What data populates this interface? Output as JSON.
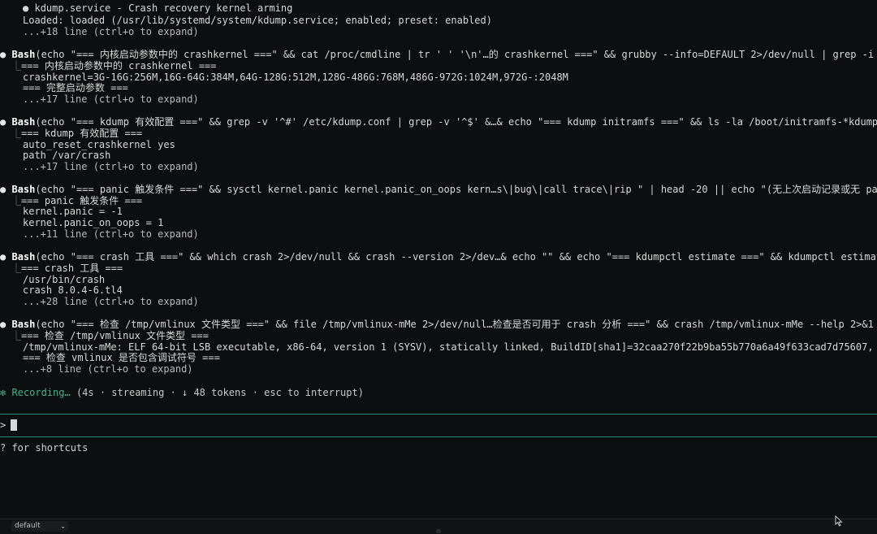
{
  "terminal": {
    "service_block": {
      "bullet": "●",
      "title": "kdump.service - Crash recovery kernel arming",
      "loaded": "Loaded: loaded (/usr/lib/systemd/system/kdump.service; enabled; preset: enabled)",
      "more": "...+18 line (ctrl+o to expand)"
    },
    "blocks": [
      {
        "dot": "●",
        "tool": "Bash",
        "command": "(echo \"=== 内核启动参数中的 crashkernel ===\" && cat /proc/cmdline | tr ' ' '\\n'…的 crashkernel ===\" && grubby --info=DEFAULT 2>/dev/null | grep -i crashk",
        "tree": "⎿",
        "lines": [
          "=== 内核启动参数中的 crashkernel ===",
          "crashkernel=3G-16G:256M,16G-64G:384M,64G-128G:512M,128G-486G:768M,486G-972G:1024M,972G-:2048M",
          "=== 完整启动参数 ===",
          "...+17 line (ctrl+o to expand)"
        ]
      },
      {
        "dot": "●",
        "tool": "Bash",
        "command": "(echo \"=== kdump 有效配置 ===\" && grep -v '^#' /etc/kdump.conf | grep -v '^$' &…& echo \"=== kdump initramfs ===\" && ls -la /boot/initramfs-*kdump* 2>/",
        "tree": "⎿",
        "lines": [
          "=== kdump 有效配置 ===",
          "auto_reset_crashkernel yes",
          "path /var/crash",
          "...+17 line (ctrl+o to expand)"
        ]
      },
      {
        "dot": "●",
        "tool": "Bash",
        "command": "(echo \"=== panic 触发条件 ===\" && sysctl kernel.panic kernel.panic_on_oops kern…s\\|bug\\|call trace\\|rip \" | head -20 || echo \"(无上次启动记录或无 panic",
        "tree": "⎿",
        "lines": [
          "=== panic 触发条件 ===",
          "kernel.panic = -1",
          "kernel.panic_on_oops = 1",
          "...+11 line (ctrl+o to expand)"
        ]
      },
      {
        "dot": "●",
        "tool": "Bash",
        "command": "(echo \"=== crash 工具 ===\" && which crash 2>/dev/null && crash --version 2>/dev…& echo \"\" && echo \"=== kdumpctl estimate ===\" && kdumpctl estimate 2>/",
        "tree": "⎿",
        "lines": [
          "=== crash 工具 ===",
          "/usr/bin/crash",
          "crash 8.0.4-6.tl4",
          "...+28 line (ctrl+o to expand)"
        ]
      },
      {
        "dot": "●",
        "tool": "Bash",
        "command": "(echo \"=== 检查 /tmp/vmlinux 文件类型 ===\" && file /tmp/vmlinux-mMe 2>/dev/null…检查是否可用于 crash 分析 ===\" && crash /tmp/vmlinux-mMe --help 2>&1 |",
        "tree": "⎿",
        "lines": [
          "=== 检查 /tmp/vmlinux 文件类型 ===",
          "/tmp/vmlinux-mMe: ELF 64-bit LSB executable, x86-64, version 1 (SYSV), statically linked, BuildID[sha1]=32caa270f22b9ba55b770a6a49f633cad7d75607, stripp",
          "=== 检查 vmlinux 是否包含调试符号 ===",
          "...+8 line (ctrl+o to expand)"
        ]
      }
    ],
    "status": {
      "icon": "✻",
      "label": "Recording…",
      "meta": "(4s · streaming · ↓ 48 tokens · esc to interrupt)"
    }
  },
  "prompt": {
    "symbol": ">",
    "value": ""
  },
  "hint": "? for shortcuts",
  "statusbar": {
    "profile": "default",
    "chevron": "⌄"
  },
  "colors": {
    "background": "#0d0e0f",
    "accent_green": "#3fb58a",
    "rule_teal": "#2f8a84"
  }
}
